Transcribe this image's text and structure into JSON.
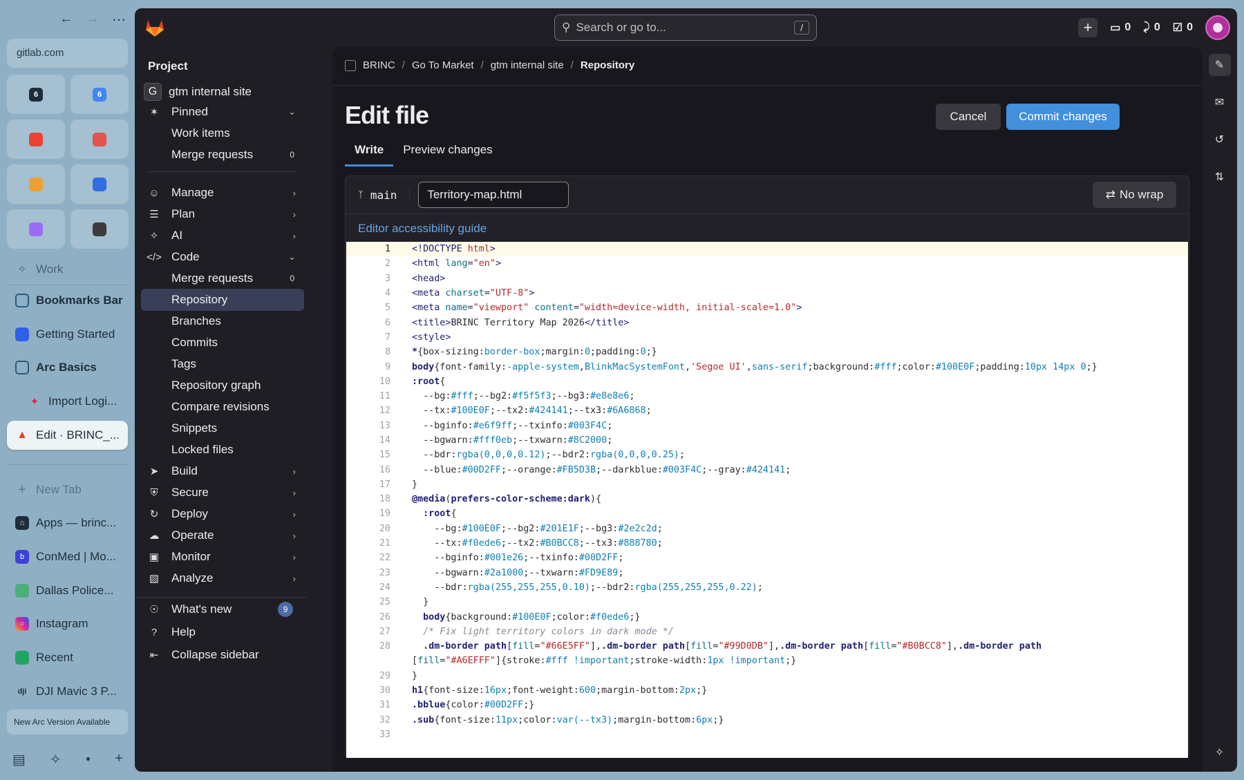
{
  "arc": {
    "url": "gitlab.com",
    "favorites": [
      {
        "icon": "calendar-icon",
        "text": "6",
        "color": "#1f2d3a"
      },
      {
        "icon": "google-calendar-icon",
        "text": "6",
        "color": "#4285f4"
      },
      {
        "icon": "gmail-icon",
        "text": "",
        "color": "#ea4335"
      },
      {
        "icon": "scissors-icon",
        "text": "",
        "color": "#e2554d"
      },
      {
        "icon": "settings-app-icon",
        "text": "",
        "color": "#f0a030"
      },
      {
        "icon": "jira-icon",
        "text": "",
        "color": "#2f6fe0"
      },
      {
        "icon": "notion-ai-icon",
        "text": "",
        "color": "#9b6cf5"
      },
      {
        "icon": "chatgpt-icon",
        "text": "",
        "color": "#3b3b3b"
      }
    ],
    "items": [
      {
        "label": "Work",
        "icon": "planet-icon"
      },
      {
        "label": "Bookmarks Bar",
        "icon": "folder-icon"
      },
      {
        "label": "Getting Started",
        "icon": "square-icon"
      },
      {
        "label": "Arc Basics",
        "icon": "folder-icon"
      },
      {
        "label": "Import Logi...",
        "icon": "rocket-icon"
      },
      {
        "label": "Edit · BRINC_...",
        "icon": "gitlab-icon"
      },
      {
        "label": "New Tab",
        "icon": "plus-icon"
      },
      {
        "label": "Apps — brinc...",
        "icon": "home-icon"
      },
      {
        "label": "ConMed | Mo...",
        "icon": "b-icon"
      },
      {
        "label": "Dallas Police...",
        "icon": "map-icon"
      },
      {
        "label": "Instagram",
        "icon": "instagram-icon"
      },
      {
        "label": "Recent",
        "icon": "sheets-icon"
      },
      {
        "label": "DJI Mavic 3 P...",
        "icon": "dji-icon"
      }
    ],
    "banner": "New Arc Version Available"
  },
  "topbar": {
    "search_placeholder": "Search or go to...",
    "search_shortcut": "/",
    "issues_count": "0",
    "mr_count": "0",
    "todo_count": "0"
  },
  "sidebar": {
    "heading": "Project",
    "project_initial": "G",
    "project_name": "gtm internal site",
    "pinned": "Pinned",
    "pinned_items": [
      {
        "label": "Work items",
        "count": ""
      },
      {
        "label": "Merge requests",
        "count": "0"
      }
    ],
    "sections": [
      {
        "label": "Manage"
      },
      {
        "label": "Plan"
      },
      {
        "label": "AI"
      },
      {
        "label": "Code"
      }
    ],
    "code_items": [
      {
        "label": "Merge requests",
        "count": "0"
      },
      {
        "label": "Repository",
        "count": ""
      },
      {
        "label": "Branches",
        "count": ""
      },
      {
        "label": "Commits",
        "count": ""
      },
      {
        "label": "Tags",
        "count": ""
      },
      {
        "label": "Repository graph",
        "count": ""
      },
      {
        "label": "Compare revisions",
        "count": ""
      },
      {
        "label": "Snippets",
        "count": ""
      },
      {
        "label": "Locked files",
        "count": ""
      }
    ],
    "more_sections": [
      {
        "label": "Build"
      },
      {
        "label": "Secure"
      },
      {
        "label": "Deploy"
      },
      {
        "label": "Operate"
      },
      {
        "label": "Monitor"
      },
      {
        "label": "Analyze"
      }
    ],
    "whats_new": "What's new",
    "whats_new_count": "9",
    "help": "Help",
    "collapse": "Collapse sidebar"
  },
  "breadcrumb": [
    "BRINC",
    "Go To Market",
    "gtm internal site",
    "Repository"
  ],
  "page": {
    "title": "Edit file",
    "cancel": "Cancel",
    "commit": "Commit changes",
    "tabs": [
      "Write",
      "Preview changes"
    ],
    "branch": "main",
    "filename": "Territory-map.html",
    "nowrap": "No wrap",
    "a11y_link": "Editor accessibility guide"
  },
  "code_lines": [
    "1",
    "2",
    "3",
    "4",
    "5",
    "6",
    "7",
    "8",
    "9",
    "10",
    "11",
    "12",
    "13",
    "14",
    "15",
    "16",
    "17",
    "18",
    "19",
    "20",
    "21",
    "22",
    "23",
    "24",
    "25",
    "26",
    "27",
    "28",
    "",
    "29",
    "30",
    "31",
    "32",
    "33"
  ]
}
